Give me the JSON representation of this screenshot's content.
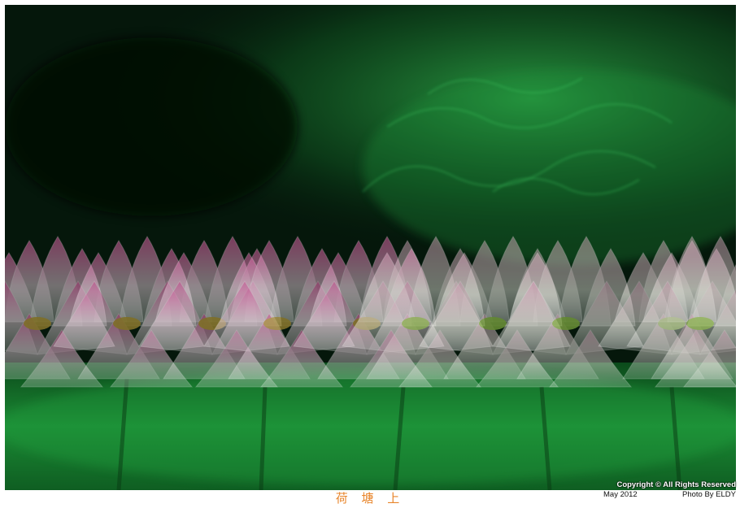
{
  "image": {
    "subject": "multi-exposure lotus flowers over green leaves",
    "colors": {
      "background_dark": "#04150a",
      "leaf_green": "#1f8f3a",
      "petal_pink": "#e45aa6",
      "petal_white": "#f1e8ee",
      "seedpod_yellow": "#c9c53a",
      "caption_orange": "#e8852a"
    }
  },
  "caption": {
    "title": "荷 塘 上"
  },
  "watermark": {
    "copyright": "Copyright © All Rights Reserved",
    "date": "May 2012",
    "credit": "Photo By ELDY"
  }
}
